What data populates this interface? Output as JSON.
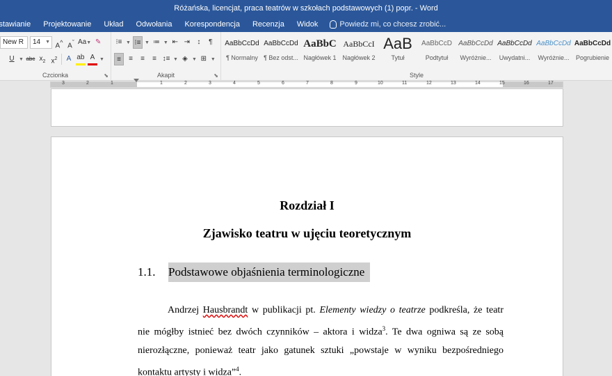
{
  "titlebar": {
    "title": "Różańska, licencjat, praca teatrów w szkołach podstawowych (1) popr. - Word"
  },
  "ribbon_tabs": [
    "Wstawianie",
    "Projektowanie",
    "Układ",
    "Odwołania",
    "Korespondencja",
    "Recenzja",
    "Widok"
  ],
  "tell_me": "Powiedz mi, co chcesz zrobić...",
  "font_group": {
    "font_name": "New R",
    "font_size": "14",
    "label": "Czcionka"
  },
  "paragraph_group": {
    "label": "Akapit"
  },
  "styles_group": {
    "label": "Style",
    "items": [
      {
        "preview": "AaBbCcDd",
        "name": "¶ Normalny"
      },
      {
        "preview": "AaBbCcDd",
        "name": "¶ Bez odst..."
      },
      {
        "preview": "AaBbC",
        "name": "Nagłówek 1"
      },
      {
        "preview": "AaBbCcI",
        "name": "Nagłówek 2"
      },
      {
        "preview": "AaB",
        "name": "Tytuł"
      },
      {
        "preview": "AaBbCcD",
        "name": "Podtytuł"
      },
      {
        "preview": "AaBbCcDd",
        "name": "Wyróżnie..."
      },
      {
        "preview": "AaBbCcDd",
        "name": "Uwydatni..."
      },
      {
        "preview": "AaBbCcDd",
        "name": "Wyróżnie..."
      },
      {
        "preview": "AaBbCcDd",
        "name": "Pogrubienie"
      }
    ]
  },
  "ruler": {
    "left_numbers": [
      "3",
      "2",
      "1"
    ],
    "right_numbers": [
      "1",
      "2",
      "3",
      "4",
      "5",
      "6",
      "7",
      "8",
      "9",
      "10",
      "11",
      "12",
      "13",
      "14",
      "15",
      "16",
      "17"
    ]
  },
  "document": {
    "chapter": "Rozdział I",
    "chapter_title": "Zjawisko teatru w ujęciu teoretycznym",
    "section_number": "1.1.",
    "section_title": "Podstawowe objaśnienia terminologiczne",
    "p1_a": "Andrzej ",
    "p1_name": "Hausbrandt",
    "p1_b": " w publikacji pt. ",
    "p1_italic": "Elementy wiedzy o teatrze",
    "p1_c": " podkreśla, że teatr",
    "p2_a": "nie mógłby istnieć bez dwóch czynników – aktora i widza",
    "p2_sup": "3",
    "p2_b": ". Te dwa ogniwa są ze sobą",
    "p3": "nierozłączne, ponieważ teatr jako gatunek sztuki „powstaje w wyniku bezpośredniego",
    "p4_a": "kontaktu artysty i widza”",
    "p4_sup": "4",
    "p4_b": "."
  },
  "colors": {
    "titlebar": "#2b579a",
    "ribbon": "#f3f3f3",
    "canvas": "#e6e6e6"
  }
}
